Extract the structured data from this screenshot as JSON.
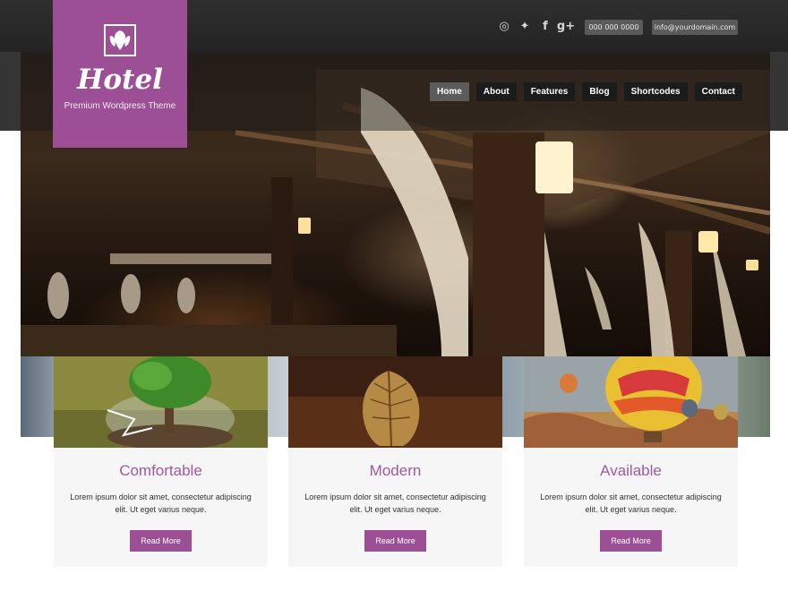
{
  "brand": {
    "name": "Hotel",
    "tagline": "Premium Wordpress Theme",
    "accent": "#9c4f94"
  },
  "header": {
    "social": [
      "dribbble-icon",
      "twitter-icon",
      "facebook-icon",
      "google-plus-icon"
    ],
    "phone": "000 000 0000",
    "email": "info@yourdomain.com"
  },
  "nav": [
    "Home",
    "About",
    "Features",
    "Blog",
    "Shortcodes",
    "Contact"
  ],
  "nav_active": "Home",
  "cards": [
    {
      "title": "Comfortable",
      "text": "Lorem ipsum dolor sit amet, consectetur adipiscing elit. Ut eget varius neque.",
      "button": "Read More"
    },
    {
      "title": "Modern",
      "text": "Lorem ipsum dolor sit amet, consectetur adipiscing elit. Ut eget varius neque.",
      "button": "Read More"
    },
    {
      "title": "Available",
      "text": "Lorem ipsum dolor sit amet, consectetur adipiscing elit. Ut eget varius neque.",
      "button": "Read More"
    }
  ]
}
